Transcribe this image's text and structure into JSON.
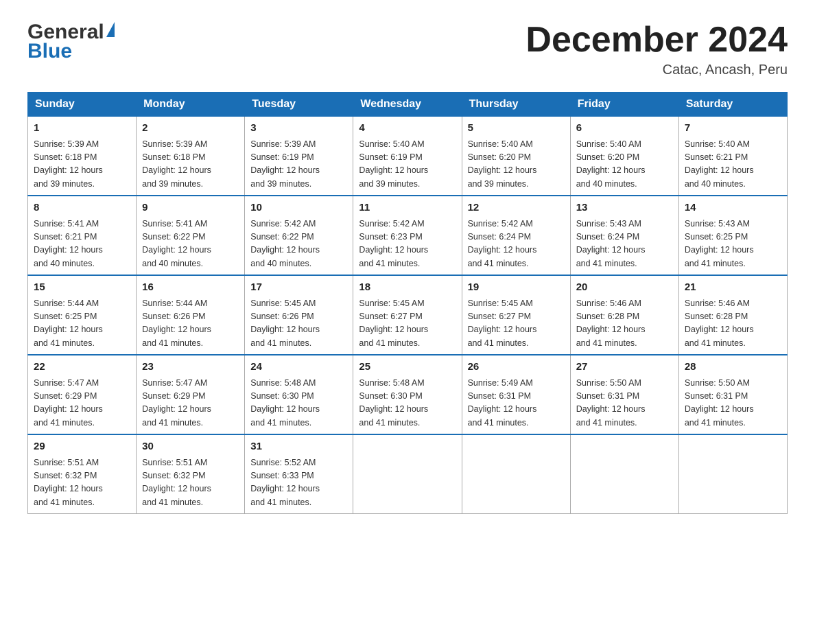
{
  "header": {
    "logo_general": "General",
    "logo_blue": "Blue",
    "month_title": "December 2024",
    "subtitle": "Catac, Ancash, Peru"
  },
  "days": [
    "Sunday",
    "Monday",
    "Tuesday",
    "Wednesday",
    "Thursday",
    "Friday",
    "Saturday"
  ],
  "weeks": [
    [
      {
        "day": "1",
        "sunrise": "5:39 AM",
        "sunset": "6:18 PM",
        "daylight": "12 hours and 39 minutes."
      },
      {
        "day": "2",
        "sunrise": "5:39 AM",
        "sunset": "6:18 PM",
        "daylight": "12 hours and 39 minutes."
      },
      {
        "day": "3",
        "sunrise": "5:39 AM",
        "sunset": "6:19 PM",
        "daylight": "12 hours and 39 minutes."
      },
      {
        "day": "4",
        "sunrise": "5:40 AM",
        "sunset": "6:19 PM",
        "daylight": "12 hours and 39 minutes."
      },
      {
        "day": "5",
        "sunrise": "5:40 AM",
        "sunset": "6:20 PM",
        "daylight": "12 hours and 39 minutes."
      },
      {
        "day": "6",
        "sunrise": "5:40 AM",
        "sunset": "6:20 PM",
        "daylight": "12 hours and 40 minutes."
      },
      {
        "day": "7",
        "sunrise": "5:40 AM",
        "sunset": "6:21 PM",
        "daylight": "12 hours and 40 minutes."
      }
    ],
    [
      {
        "day": "8",
        "sunrise": "5:41 AM",
        "sunset": "6:21 PM",
        "daylight": "12 hours and 40 minutes."
      },
      {
        "day": "9",
        "sunrise": "5:41 AM",
        "sunset": "6:22 PM",
        "daylight": "12 hours and 40 minutes."
      },
      {
        "day": "10",
        "sunrise": "5:42 AM",
        "sunset": "6:22 PM",
        "daylight": "12 hours and 40 minutes."
      },
      {
        "day": "11",
        "sunrise": "5:42 AM",
        "sunset": "6:23 PM",
        "daylight": "12 hours and 41 minutes."
      },
      {
        "day": "12",
        "sunrise": "5:42 AM",
        "sunset": "6:24 PM",
        "daylight": "12 hours and 41 minutes."
      },
      {
        "day": "13",
        "sunrise": "5:43 AM",
        "sunset": "6:24 PM",
        "daylight": "12 hours and 41 minutes."
      },
      {
        "day": "14",
        "sunrise": "5:43 AM",
        "sunset": "6:25 PM",
        "daylight": "12 hours and 41 minutes."
      }
    ],
    [
      {
        "day": "15",
        "sunrise": "5:44 AM",
        "sunset": "6:25 PM",
        "daylight": "12 hours and 41 minutes."
      },
      {
        "day": "16",
        "sunrise": "5:44 AM",
        "sunset": "6:26 PM",
        "daylight": "12 hours and 41 minutes."
      },
      {
        "day": "17",
        "sunrise": "5:45 AM",
        "sunset": "6:26 PM",
        "daylight": "12 hours and 41 minutes."
      },
      {
        "day": "18",
        "sunrise": "5:45 AM",
        "sunset": "6:27 PM",
        "daylight": "12 hours and 41 minutes."
      },
      {
        "day": "19",
        "sunrise": "5:45 AM",
        "sunset": "6:27 PM",
        "daylight": "12 hours and 41 minutes."
      },
      {
        "day": "20",
        "sunrise": "5:46 AM",
        "sunset": "6:28 PM",
        "daylight": "12 hours and 41 minutes."
      },
      {
        "day": "21",
        "sunrise": "5:46 AM",
        "sunset": "6:28 PM",
        "daylight": "12 hours and 41 minutes."
      }
    ],
    [
      {
        "day": "22",
        "sunrise": "5:47 AM",
        "sunset": "6:29 PM",
        "daylight": "12 hours and 41 minutes."
      },
      {
        "day": "23",
        "sunrise": "5:47 AM",
        "sunset": "6:29 PM",
        "daylight": "12 hours and 41 minutes."
      },
      {
        "day": "24",
        "sunrise": "5:48 AM",
        "sunset": "6:30 PM",
        "daylight": "12 hours and 41 minutes."
      },
      {
        "day": "25",
        "sunrise": "5:48 AM",
        "sunset": "6:30 PM",
        "daylight": "12 hours and 41 minutes."
      },
      {
        "day": "26",
        "sunrise": "5:49 AM",
        "sunset": "6:31 PM",
        "daylight": "12 hours and 41 minutes."
      },
      {
        "day": "27",
        "sunrise": "5:50 AM",
        "sunset": "6:31 PM",
        "daylight": "12 hours and 41 minutes."
      },
      {
        "day": "28",
        "sunrise": "5:50 AM",
        "sunset": "6:31 PM",
        "daylight": "12 hours and 41 minutes."
      }
    ],
    [
      {
        "day": "29",
        "sunrise": "5:51 AM",
        "sunset": "6:32 PM",
        "daylight": "12 hours and 41 minutes."
      },
      {
        "day": "30",
        "sunrise": "5:51 AM",
        "sunset": "6:32 PM",
        "daylight": "12 hours and 41 minutes."
      },
      {
        "day": "31",
        "sunrise": "5:52 AM",
        "sunset": "6:33 PM",
        "daylight": "12 hours and 41 minutes."
      },
      null,
      null,
      null,
      null
    ]
  ],
  "labels": {
    "sunrise": "Sunrise:",
    "sunset": "Sunset:",
    "daylight": "Daylight:"
  }
}
